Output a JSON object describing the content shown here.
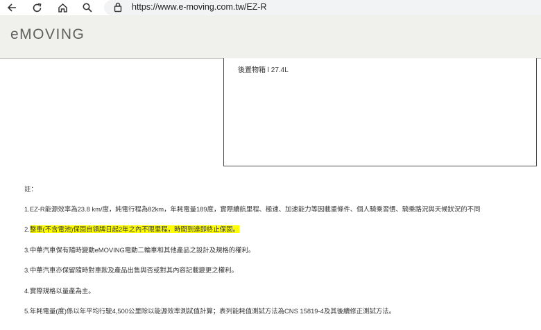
{
  "browser": {
    "url": "https://www.e-moving.com.tw/EZ-R",
    "icons": [
      "back-icon",
      "reload-icon",
      "home-icon",
      "search-icon",
      "lock-icon"
    ]
  },
  "header": {
    "logo": "eMOVING"
  },
  "spec": {
    "storage": "後置物箱 l 27.4L"
  },
  "notes": {
    "title": "註：",
    "n1": "1.EZ-R能源效率為23.8 km/度，純電行程為82km，年耗電量189度，實際續航里程、極速、加速能力等因載重條件、個人騎乘習慣、騎乘路況與天候狀況的不同",
    "n2_prefix": "2.",
    "n2_highlight": "整車(不含電池)保固自領牌日起2年之內不限里程，時間到達即終止保固。",
    "n3": "3.中華汽車保有隨時變動eMOVING電動二輪車和其他產品之設計及規格的權利。",
    "n4": "3.中華汽車亦保留隨時對車款及產品出售與否或對其內容記載變更之權利。",
    "n5": "4.實際規格以量產為主。",
    "n6": "5.年耗電量(度)係以年平均行駛4,500公里除以能源效率測試值計算；表列能耗值測試方法為CNS 15819-4及其後續修正測試方法。"
  },
  "colors": {
    "header_bg": "#f0f0ec",
    "highlight": "#ffff00",
    "address_bar": "#f1f3f4"
  }
}
